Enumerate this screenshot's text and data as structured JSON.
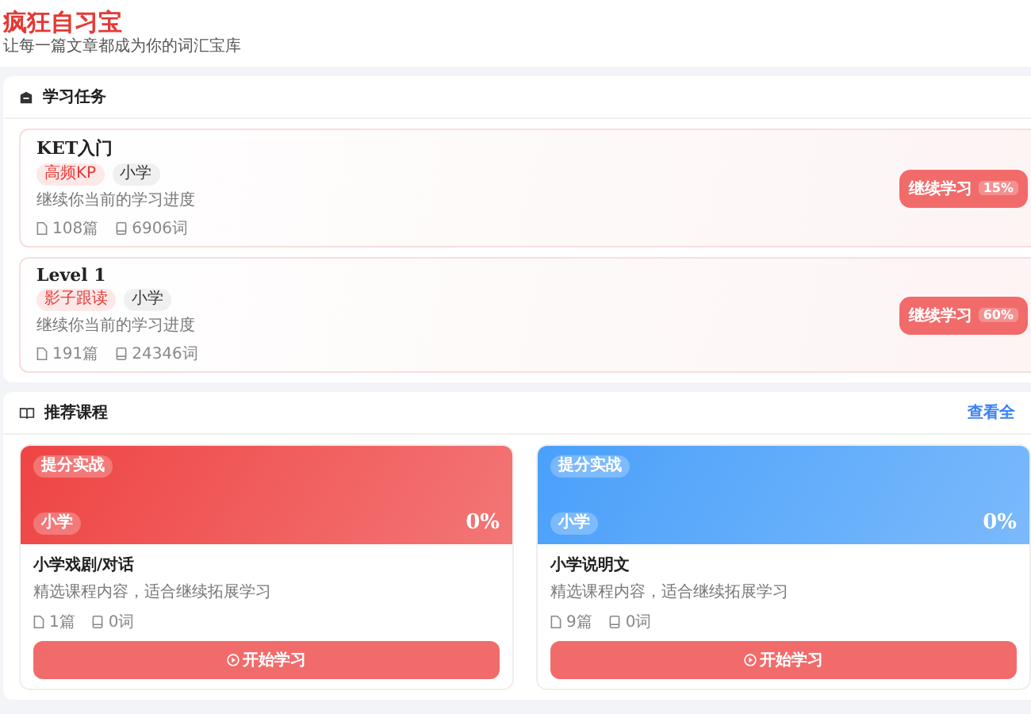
{
  "app": {
    "title": "疯狂自习宝",
    "subtitle": "让每一篇文章都成为你的词汇宝库"
  },
  "tasks_section": {
    "title": "学习任务",
    "tasks": [
      {
        "title": "KET入门",
        "tags": [
          {
            "label": "高频KP",
            "kind": "accent"
          },
          {
            "label": "小学",
            "kind": "plain"
          }
        ],
        "description": "继续你当前的学习进度",
        "articles": "108篇",
        "words": "6906词",
        "button": "继续学习",
        "progress": "15%"
      },
      {
        "title": "Level 1",
        "tags": [
          {
            "label": "影子跟读",
            "kind": "accent"
          },
          {
            "label": "小学",
            "kind": "plain"
          }
        ],
        "description": "继续你当前的学习进度",
        "articles": "191篇",
        "words": "24346词",
        "button": "继续学习",
        "progress": "60%"
      }
    ]
  },
  "courses_section": {
    "title": "推荐课程",
    "view_all": "查看全",
    "courses": [
      {
        "color": "#ef4444",
        "tags": [
          "提分实战",
          "小学"
        ],
        "progress": "0%",
        "title": "小学戏剧/对话",
        "description": "精选课程内容，适合继续拓展学习",
        "articles": "1篇",
        "words": "0词",
        "button": "开始学习"
      },
      {
        "color": "#4aa0fa",
        "tags": [
          "提分实战",
          "小学"
        ],
        "progress": "0%",
        "title": "小学说明文",
        "description": "精选课程内容，适合继续拓展学习",
        "articles": "9篇",
        "words": "0词",
        "button": "开始学习"
      }
    ]
  }
}
